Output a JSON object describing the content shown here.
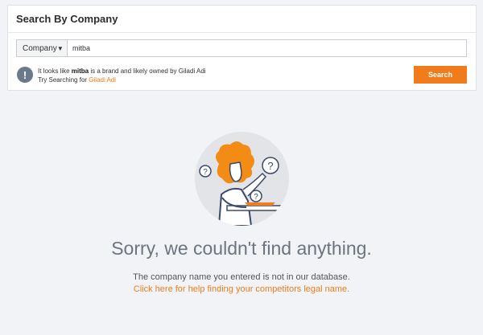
{
  "panel": {
    "title": "Search By Company"
  },
  "search": {
    "type_label": "Company",
    "query_value": "mitba",
    "button_label": "Search"
  },
  "hint": {
    "icon": "exclamation-icon",
    "prefix": "It looks like ",
    "brand": "mitba",
    "middle": " is a brand and likely owned by Giladi Adi",
    "try_prefix": "Try Searching for ",
    "suggestion": "Giladi Adi"
  },
  "empty_state": {
    "title": "Sorry, we couldn't find anything.",
    "message": "The company name you entered is not in our database.",
    "help_link": "Click here for help finding your competitors legal name."
  },
  "colors": {
    "accent": "#f07c1b",
    "background": "#f1f3f6",
    "panel": "#ffffff"
  }
}
